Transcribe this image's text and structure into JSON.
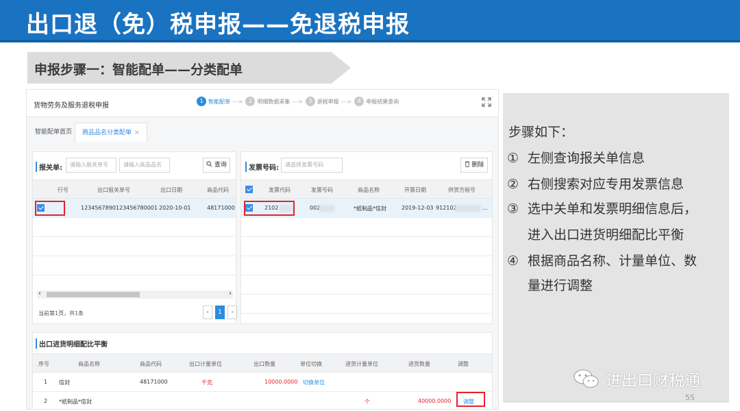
{
  "slide": {
    "title": "出口退（免）税申报——免退税申报",
    "step_banner": "申报步骤一：智能配单——分类配单",
    "page_number": "55"
  },
  "app": {
    "title": "货物劳务及服务退税申报",
    "wizard": [
      {
        "num": "1",
        "label": "智能配单"
      },
      {
        "num": "2",
        "label": "明细数据采集"
      },
      {
        "num": "3",
        "label": "退税申报"
      },
      {
        "num": "4",
        "label": "申报结果查询"
      }
    ],
    "wizard_arrow": "--->",
    "tabs": {
      "home": "智能配单首页",
      "current": "商品品名分类配单",
      "close": "×"
    },
    "customs": {
      "label": "报关单:",
      "input1_placeholder": "请输入报关单号",
      "input2_placeholder": "请输入商品品名",
      "query_button": "查询",
      "headers": [
        "行号",
        "出口报关单号",
        "出口日期",
        "商品代码"
      ],
      "row": {
        "declaration_no": "1234567890123456780001",
        "export_date": "2020-10-01",
        "commodity_code": "48171000"
      },
      "scroll_left": "‹",
      "scroll_right": "›",
      "pager_text": "当前第1页，共1条",
      "pager_prev": "‹",
      "pager_page": "1",
      "pager_next": "›"
    },
    "invoice": {
      "label": "发票号码:",
      "input_placeholder": "请选择发票号码",
      "delete_button": "删除",
      "headers": [
        "发票代码",
        "发票号码",
        "商品名称",
        "开票日期",
        "供货方税号"
      ],
      "row": {
        "invoice_code": "2102",
        "invoice_no": "002",
        "name": "*纸制品*信封",
        "date": "2019-12-03",
        "tax_no": "912102",
        "more": "..."
      }
    },
    "balance": {
      "title": "出口进货明细配比平衡",
      "headers": [
        "序号",
        "商品名称",
        "商品代码",
        "出口计量单位",
        "出口数量",
        "单位切换",
        "进货计量单位",
        "进货数量",
        "调整"
      ],
      "rows": [
        {
          "no": "1",
          "name": "信封",
          "code": "48171000",
          "export_unit": "千克",
          "export_qty": "10000.0000",
          "switch": "切换单位",
          "purchase_unit": "",
          "purchase_qty": "",
          "adjust": ""
        },
        {
          "no": "2",
          "name": "*纸制品*信封",
          "code": "",
          "export_unit": "",
          "export_qty": "",
          "switch": "",
          "purchase_unit": "个",
          "purchase_qty": "40000.0000",
          "adjust": "调整"
        }
      ]
    }
  },
  "info": {
    "heading": "步骤如下：",
    "items": [
      {
        "num": "①",
        "lines": [
          "左侧查询报关单信息"
        ]
      },
      {
        "num": "②",
        "lines": [
          "右侧搜索对应专用发票信息"
        ]
      },
      {
        "num": "③",
        "lines": [
          "选中关单和发票明细信息后，",
          "进入出口进货明细配比平衡"
        ]
      },
      {
        "num": "④",
        "lines": [
          "根据商品名称、计量单位、数",
          "量进行调整"
        ]
      }
    ]
  },
  "brand": {
    "name": "进出口财税通",
    "icon": "wechat-icon"
  },
  "colors": {
    "title_bar": "#1a73c0",
    "accent_blue": "#2b8ce0",
    "highlight_red": "#e0242d",
    "info_panel": "#e4e4e4"
  }
}
